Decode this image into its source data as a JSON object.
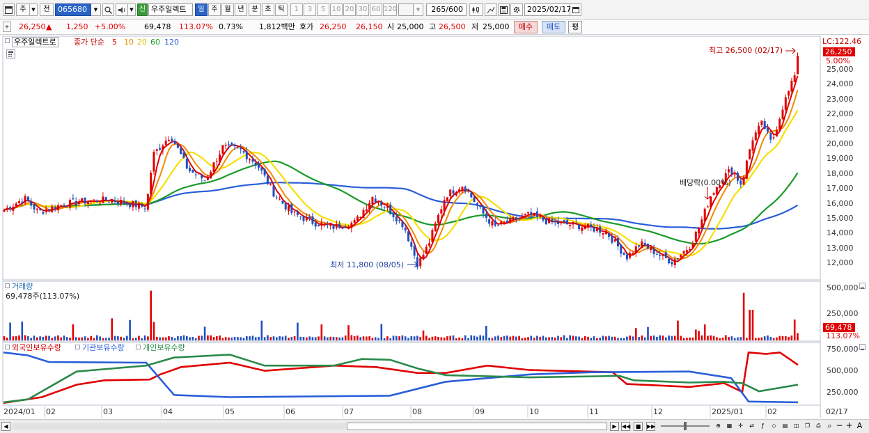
{
  "toolbar": {
    "market_btn": "주",
    "prev_btn": "전",
    "code": "065680",
    "stock_tag": "신",
    "stock_name": "우주일렉트",
    "period_tabs": [
      {
        "label": "일",
        "active": true
      },
      {
        "label": "주",
        "active": false
      },
      {
        "label": "월",
        "active": false
      },
      {
        "label": "년",
        "active": false
      },
      {
        "label": "분",
        "active": false
      },
      {
        "label": "초",
        "active": false
      },
      {
        "label": "틱",
        "active": false
      }
    ],
    "intervals": [
      "1",
      "3",
      "5",
      "10",
      "20",
      "30",
      "60",
      "120"
    ],
    "count": "265",
    "count_total": "/600",
    "date": "2025/02/17"
  },
  "quote": {
    "price": "26,250",
    "arrow": "▲",
    "change": "1,250",
    "change_pct": "+5.00%",
    "volume": "69,478",
    "volume_ratio": "113.07%",
    "turnover": "0.73%",
    "amount": "1,812백만",
    "ask_label": "호가",
    "ask": "26,250",
    "bid": "26,150",
    "open_label": "시",
    "open": "25,000",
    "high_label": "고",
    "high": "26,500",
    "low_label": "저",
    "low": "25,000",
    "buy_btn": "매수",
    "sell_btn": "매도",
    "eval_btn": "평"
  },
  "price_panel": {
    "legend_name": "우주일렉트로",
    "legend_ma": "종가 단순",
    "ma_periods": [
      "5",
      "10",
      "20",
      "60",
      "120"
    ],
    "lc_label": "LC:122.46",
    "last_price": "26,250",
    "last_pct": "5.00%",
    "yticks": [
      "25,000",
      "24,000",
      "23,000",
      "22,000",
      "21,000",
      "20,000",
      "19,000",
      "18,000",
      "17,000",
      "16,000",
      "15,000",
      "14,000",
      "13,000",
      "12,000"
    ],
    "high_note": "최고 26,500 (02/17)",
    "low_note": "최저 11,800 (08/05)",
    "dividend_note": "배당락(0.00%)"
  },
  "volume_panel": {
    "title": "거래량",
    "summary": "69,478주(113.07%)",
    "yticks": [
      "500,000",
      "250,000"
    ],
    "last_value": "69,478",
    "last_pct": "113.07%"
  },
  "holdings_panel": {
    "series": [
      "외국인보유수량",
      "기관보유수량",
      "개인보유수량"
    ],
    "yticks": [
      "750,000",
      "500,000",
      "250,000"
    ]
  },
  "xaxis": {
    "labels": [
      "2024/01",
      "02",
      "03",
      "04",
      "05",
      "06",
      "07",
      "08",
      "09",
      "10",
      "11",
      "12",
      "2025/01",
      "02"
    ],
    "right_label": "02/17"
  },
  "colors": {
    "up": "#e00000",
    "down": "#1f4fbf",
    "ma5": "#e00000",
    "ma10": "#f08a00",
    "ma20": "#f5e000",
    "ma60": "#1a9a2a",
    "ma120": "#2a5ed9"
  },
  "chart_data": {
    "type": "candlestick",
    "x_range": [
      "2024/01",
      "2025/02/17"
    ],
    "price_axis": [
      11500,
      26500
    ],
    "price_keypoints": [
      {
        "date": "2024/01",
        "close": 15800
      },
      {
        "date": "2024/03",
        "close": 16300
      },
      {
        "date": "2024/04",
        "close": 20800
      },
      {
        "date": "2024/05",
        "close": 20000
      },
      {
        "date": "2024/06",
        "close": 16000
      },
      {
        "date": "2024/07",
        "close": 14700
      },
      {
        "date": "2024/07 late",
        "close": 16700
      },
      {
        "date": "2024/08/05",
        "low": 11800
      },
      {
        "date": "2024/08 late",
        "close": 17500
      },
      {
        "date": "2024/10",
        "close": 15400
      },
      {
        "date": "2024/12",
        "close": 12500
      },
      {
        "date": "2025/01",
        "close": 17500
      },
      {
        "date": "2025/02/17",
        "open": 25000,
        "high": 26500,
        "low": 25000,
        "close": 26250
      }
    ],
    "moving_averages": [
      "5",
      "10",
      "20",
      "60",
      "120"
    ],
    "volume_last": 69478,
    "volume_axis": [
      0,
      500000
    ],
    "holdings_axis": [
      0,
      750000
    ],
    "holdings_series": [
      {
        "name": "외국인보유수량",
        "start": 10000,
        "end": 530000
      },
      {
        "name": "기관보유수량",
        "start": 700000,
        "end": 20000
      },
      {
        "name": "개인보유수량",
        "start": 20000,
        "end": 260000
      }
    ]
  }
}
